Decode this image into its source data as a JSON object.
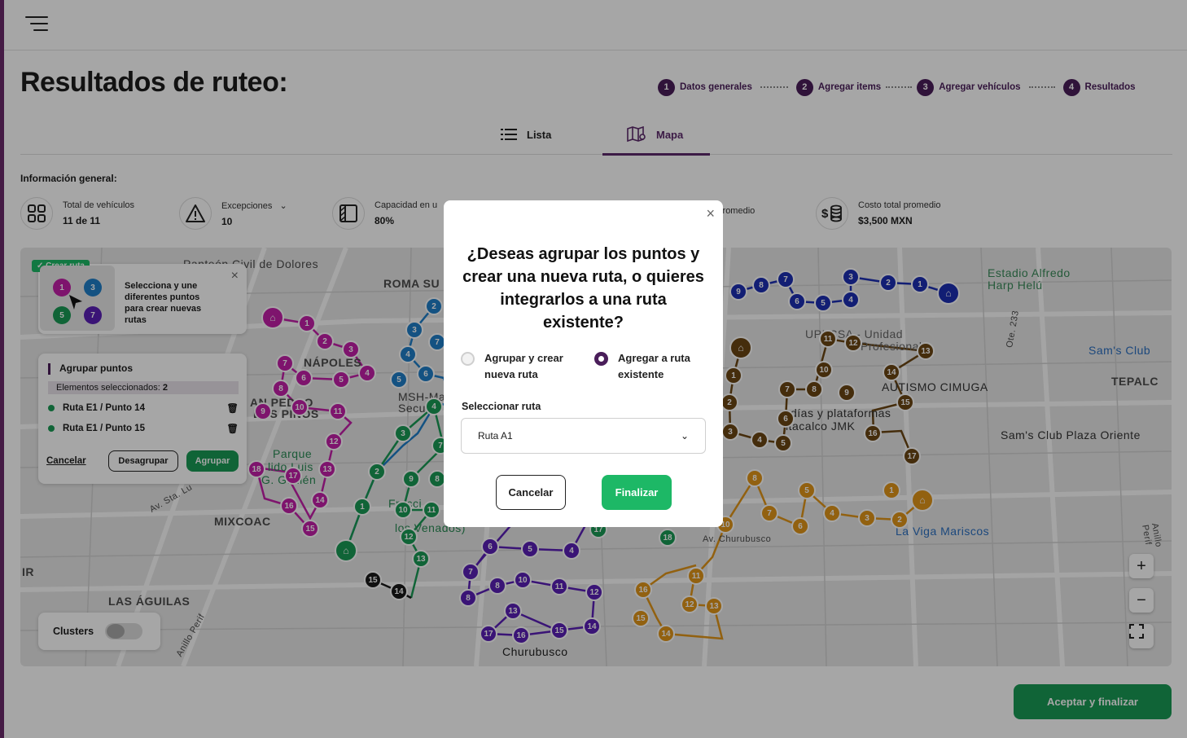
{
  "header": {
    "menu_icon": "hamburger-menu-icon"
  },
  "page": {
    "title": "Resultados de ruteo:"
  },
  "stepper": [
    {
      "num": "1",
      "label": "Datos generales"
    },
    {
      "num": "2",
      "label": "Agregar items"
    },
    {
      "num": "3",
      "label": "Agregar vehículos"
    },
    {
      "num": "4",
      "label": "Resultados"
    }
  ],
  "tabs": {
    "list": "Lista",
    "map": "Mapa"
  },
  "info": {
    "title": "Información general:",
    "kpis": [
      {
        "label": "Total de vehículos",
        "value": "11 de 11",
        "icon": "grid-icon"
      },
      {
        "label": "Excepciones",
        "value": "10",
        "icon": "warning-icon"
      },
      {
        "label": "Capacidad en u",
        "value": "80%",
        "icon": "capacity-icon"
      },
      {
        "label": "npo promedio",
        "value": "",
        "icon": "clock-icon"
      },
      {
        "label": "Costo total promedio",
        "value": "$3,500 MXN",
        "icon": "money-icon"
      }
    ]
  },
  "map": {
    "labels": {
      "panteon": "Panteón Civil de Dolores",
      "roma": "ROMA SU",
      "napoles": "NÁPOLES",
      "sanpedro": "AN PEDRO",
      "pinos": "LOS PINOS",
      "mixcoac": "MIXCOAC",
      "aguilas": "LAS ÁGUILAS",
      "churubusco": "Churubusco",
      "estadio": "Estadio Alfredo Harp Helú",
      "sams": "Sam's Club",
      "tepalc": "TEPALC",
      "autismo": "AUTISMO CIMUGA",
      "samsplaza": "Sam's Club Plaza Oriente",
      "plataformas": "días y plataformas",
      "jmk": "ltacalco JMK",
      "laviga": "La Viga Mariscos",
      "upiicsa": "UPIICSA - Unidad",
      "profesional": "Profesional",
      "msh": "MSH-Ma",
      "secu": "Secu",
      "parque": "Parque",
      "lidoluis": "lido Luis",
      "guillen": "G. Guillén",
      "venados": "los Venados)",
      "fracc": "Fracci",
      "avsta": "Av. Sta. Lu",
      "anillo": "Anillo Perif",
      "ir": "IR",
      "av_churubusco": "Av. Churubusco",
      "ote": "Ote. 233",
      "anillo_right": "Anillo Perif"
    },
    "crear_ruta": {
      "badge": "✓ Crear ruta",
      "text": "Selecciona y une diferentes puntos para crear nuevas rutas",
      "points": [
        "1",
        "3",
        "5",
        "7"
      ]
    },
    "group_panel": {
      "title": "Agrupar puntos",
      "selected_label": "Elementos seleccionados:",
      "selected_count": "2",
      "items": [
        "Ruta E1 / Punto 14",
        "Ruta E1 / Punto 15"
      ],
      "cancel": "Cancelar",
      "ungroup": "Desagrupar",
      "group": "Agrupar"
    },
    "clusters": {
      "label": "Clusters",
      "enabled": false
    }
  },
  "modal": {
    "title": "¿Deseas agrupar los puntos y crear una nueva ruta, o quieres integrarlos a una ruta existente?",
    "option_new": "Agrupar y crear nueva ruta",
    "option_existing": "Agregar a ruta existente",
    "selected_option": "existing",
    "select_label": "Seleccionar ruta",
    "select_value": "Ruta A1",
    "cancel": "Cancelar",
    "finish": "Finalizar"
  },
  "footer": {
    "accept": "Aceptar y finalizar"
  },
  "colors": {
    "primary": "#4a1e5a",
    "green": "#1db866",
    "magenta": "#c21fa8",
    "blue_light": "#1f7ec8",
    "blue_dark": "#1d2fb2",
    "purple": "#5a1fb6",
    "green_route": "#1a9a55",
    "brown": "#6b4513",
    "orange": "#e0951a",
    "black": "#1a1a1a"
  }
}
